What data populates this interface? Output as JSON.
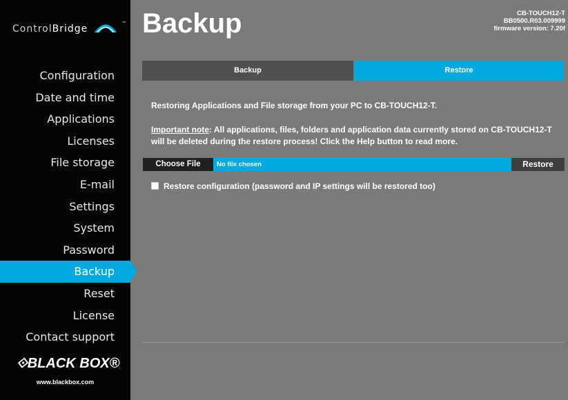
{
  "brand": {
    "logo_text_1": "Control",
    "logo_text_2": "Bridge",
    "logo_tm": "™",
    "vendor_logo": "⟐BLACK BOX®",
    "vendor_url": "www.blackbox.com"
  },
  "nav": {
    "items": [
      {
        "label": "Configuration"
      },
      {
        "label": "Date and time"
      },
      {
        "label": "Applications"
      },
      {
        "label": "Licenses"
      },
      {
        "label": "File storage"
      },
      {
        "label": "E-mail"
      },
      {
        "label": "Settings"
      },
      {
        "label": "System"
      },
      {
        "label": "Password"
      },
      {
        "label": "Backup"
      },
      {
        "label": "Reset"
      },
      {
        "label": "License"
      },
      {
        "label": "Contact support"
      }
    ],
    "active": "Backup"
  },
  "header": {
    "title": "Backup",
    "device_name": "CB-TOUCH12-T",
    "serial": "BB0500.R03.009999",
    "firmware": "firmware version: 7.20f"
  },
  "tabs": {
    "backup": "Backup",
    "restore": "Restore"
  },
  "main": {
    "intro": "Restoring Applications and File storage from your PC to CB-TOUCH12-T.",
    "note_label": "Important note",
    "note_text": ": All applications, files, folders and application data currently stored on CB-TOUCH12-T will be deleted during the restore process! Click the Help button to read more.",
    "choose_file": "Choose File",
    "file_status": "No file chosen",
    "restore_button": "Restore",
    "restore_config_label": "Restore configuration (password and IP settings will be restored too)",
    "restore_config_checked": false
  },
  "colors": {
    "accent": "#00a9de",
    "sidebar": "#050505",
    "background": "#7a7a7a"
  }
}
